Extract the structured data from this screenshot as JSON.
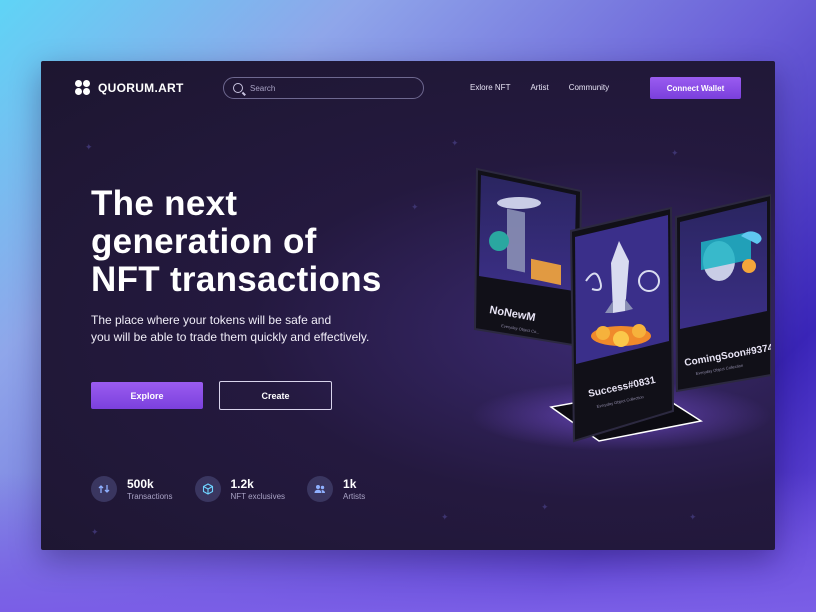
{
  "brand": {
    "name": "QUORUM.ART"
  },
  "search": {
    "placeholder": "Search"
  },
  "nav": {
    "links": [
      "Exlore NFT",
      "Artist",
      "Community"
    ],
    "cta": "Connect Wallet"
  },
  "hero": {
    "title_lines": [
      "The next",
      "generation of",
      "NFT transactions"
    ],
    "subtitle_lines": [
      "The place where your tokens will be safe and",
      "you will be able to trade them quickly and effectively."
    ],
    "primary_button": "Explore",
    "secondary_button": "Create"
  },
  "stats": [
    {
      "value": "500k",
      "label": "Transactions",
      "icon": "transfer-icon"
    },
    {
      "value": "1.2k",
      "label": "NFT exclusives",
      "icon": "cube-icon"
    },
    {
      "value": "1k",
      "label": "Artists",
      "icon": "users-icon"
    }
  ],
  "cards": [
    {
      "title": "NoNewM",
      "caption": "Everyday Object Co..."
    },
    {
      "title": "Success#0831",
      "caption": "Everyday Object Collection"
    },
    {
      "title": "ComingSoon#9374",
      "caption": "Everyday Object Collection"
    }
  ],
  "colors": {
    "accent": "#8b4fe8",
    "background": "#1d1630",
    "stat_icon_bg": "#3a3660"
  }
}
